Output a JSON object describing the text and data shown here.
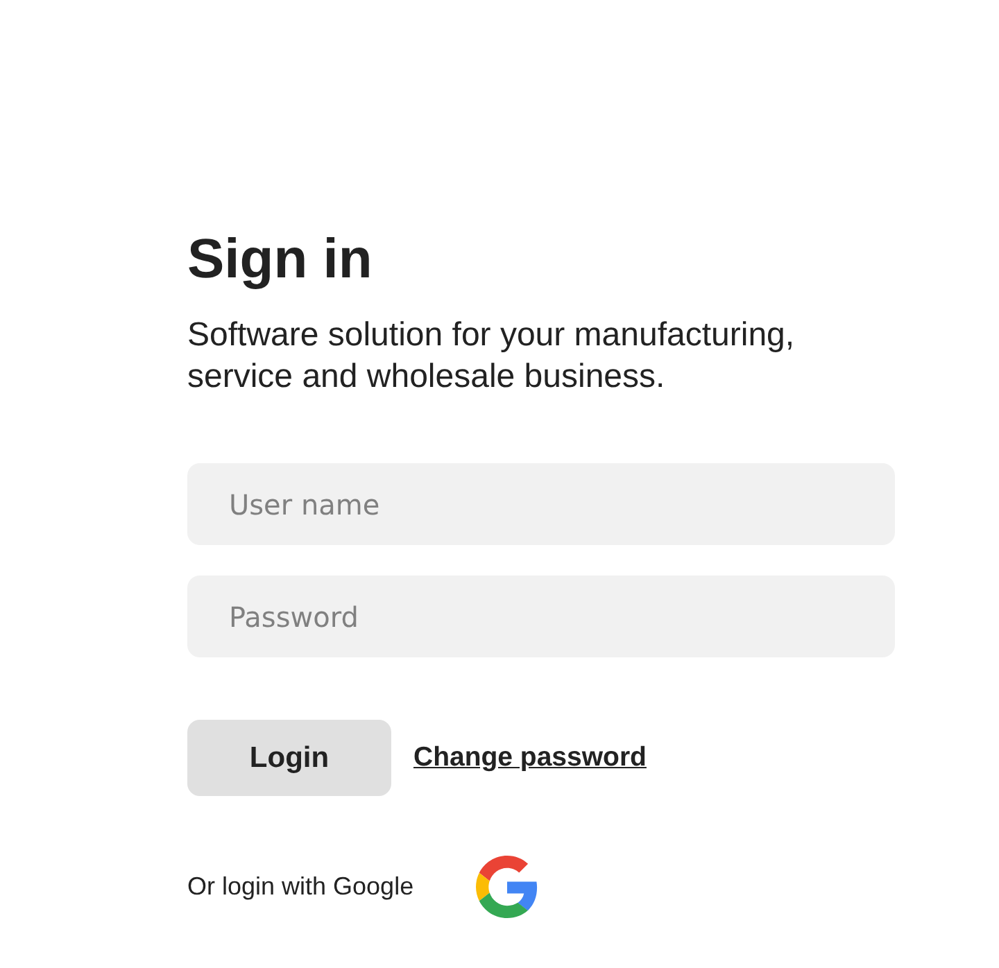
{
  "title": "Sign in",
  "subtitle": "Software solution for your manufacturing, service and wholesale business.",
  "fields": [
    {
      "placeholder": "User name"
    },
    {
      "placeholder": "Password"
    }
  ],
  "actions": {
    "login_button": "Login",
    "change_password_link": "Change password"
  },
  "google": {
    "label": "Or login with Google"
  }
}
